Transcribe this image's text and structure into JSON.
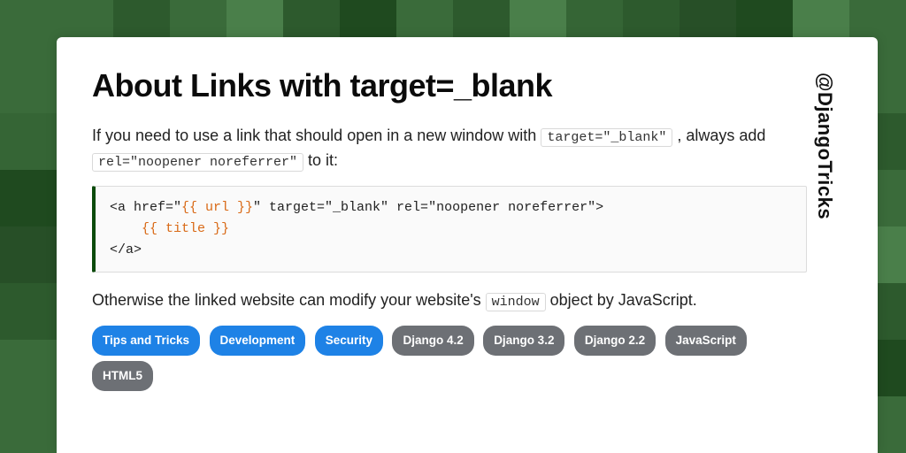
{
  "handle": "@DjangoTricks",
  "title": "About Links with target=_blank",
  "lead_parts": {
    "t1": "If you need to use a link that should open in a new window with ",
    "code1": "target=\"_blank\"",
    "t2": " , always add ",
    "code2": "rel=\"noopener noreferrer\"",
    "t3": "  to it:"
  },
  "code": {
    "l1a": "<a href=\"",
    "l1b": "{{ url }}",
    "l1c": "\" target=\"_blank\" rel=\"noopener noreferrer\">",
    "l2a": "    ",
    "l2b": "{{ title }}",
    "l3": "</a>"
  },
  "outro_parts": {
    "t1": "Otherwise the linked website can modify your website's  ",
    "code1": "window",
    "t2": "  object by JavaScript."
  },
  "tags_primary": [
    "Tips and Tricks",
    "Development",
    "Security"
  ],
  "tags_secondary": [
    "Django 4.2",
    "Django 3.2",
    "Django 2.2",
    "JavaScript",
    "HTML5"
  ]
}
